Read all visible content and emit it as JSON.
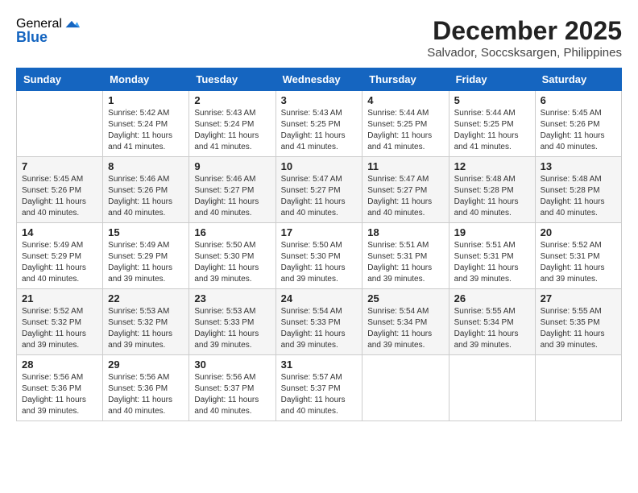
{
  "header": {
    "logo_general": "General",
    "logo_blue": "Blue",
    "month_title": "December 2025",
    "location": "Salvador, Soccsksargen, Philippines"
  },
  "days_of_week": [
    "Sunday",
    "Monday",
    "Tuesday",
    "Wednesday",
    "Thursday",
    "Friday",
    "Saturday"
  ],
  "weeks": [
    [
      {
        "day": "",
        "sunrise": "",
        "sunset": "",
        "daylight": ""
      },
      {
        "day": "1",
        "sunrise": "Sunrise: 5:42 AM",
        "sunset": "Sunset: 5:24 PM",
        "daylight": "Daylight: 11 hours and 41 minutes."
      },
      {
        "day": "2",
        "sunrise": "Sunrise: 5:43 AM",
        "sunset": "Sunset: 5:24 PM",
        "daylight": "Daylight: 11 hours and 41 minutes."
      },
      {
        "day": "3",
        "sunrise": "Sunrise: 5:43 AM",
        "sunset": "Sunset: 5:25 PM",
        "daylight": "Daylight: 11 hours and 41 minutes."
      },
      {
        "day": "4",
        "sunrise": "Sunrise: 5:44 AM",
        "sunset": "Sunset: 5:25 PM",
        "daylight": "Daylight: 11 hours and 41 minutes."
      },
      {
        "day": "5",
        "sunrise": "Sunrise: 5:44 AM",
        "sunset": "Sunset: 5:25 PM",
        "daylight": "Daylight: 11 hours and 41 minutes."
      },
      {
        "day": "6",
        "sunrise": "Sunrise: 5:45 AM",
        "sunset": "Sunset: 5:26 PM",
        "daylight": "Daylight: 11 hours and 40 minutes."
      }
    ],
    [
      {
        "day": "7",
        "sunrise": "Sunrise: 5:45 AM",
        "sunset": "Sunset: 5:26 PM",
        "daylight": "Daylight: 11 hours and 40 minutes."
      },
      {
        "day": "8",
        "sunrise": "Sunrise: 5:46 AM",
        "sunset": "Sunset: 5:26 PM",
        "daylight": "Daylight: 11 hours and 40 minutes."
      },
      {
        "day": "9",
        "sunrise": "Sunrise: 5:46 AM",
        "sunset": "Sunset: 5:27 PM",
        "daylight": "Daylight: 11 hours and 40 minutes."
      },
      {
        "day": "10",
        "sunrise": "Sunrise: 5:47 AM",
        "sunset": "Sunset: 5:27 PM",
        "daylight": "Daylight: 11 hours and 40 minutes."
      },
      {
        "day": "11",
        "sunrise": "Sunrise: 5:47 AM",
        "sunset": "Sunset: 5:27 PM",
        "daylight": "Daylight: 11 hours and 40 minutes."
      },
      {
        "day": "12",
        "sunrise": "Sunrise: 5:48 AM",
        "sunset": "Sunset: 5:28 PM",
        "daylight": "Daylight: 11 hours and 40 minutes."
      },
      {
        "day": "13",
        "sunrise": "Sunrise: 5:48 AM",
        "sunset": "Sunset: 5:28 PM",
        "daylight": "Daylight: 11 hours and 40 minutes."
      }
    ],
    [
      {
        "day": "14",
        "sunrise": "Sunrise: 5:49 AM",
        "sunset": "Sunset: 5:29 PM",
        "daylight": "Daylight: 11 hours and 40 minutes."
      },
      {
        "day": "15",
        "sunrise": "Sunrise: 5:49 AM",
        "sunset": "Sunset: 5:29 PM",
        "daylight": "Daylight: 11 hours and 39 minutes."
      },
      {
        "day": "16",
        "sunrise": "Sunrise: 5:50 AM",
        "sunset": "Sunset: 5:30 PM",
        "daylight": "Daylight: 11 hours and 39 minutes."
      },
      {
        "day": "17",
        "sunrise": "Sunrise: 5:50 AM",
        "sunset": "Sunset: 5:30 PM",
        "daylight": "Daylight: 11 hours and 39 minutes."
      },
      {
        "day": "18",
        "sunrise": "Sunrise: 5:51 AM",
        "sunset": "Sunset: 5:31 PM",
        "daylight": "Daylight: 11 hours and 39 minutes."
      },
      {
        "day": "19",
        "sunrise": "Sunrise: 5:51 AM",
        "sunset": "Sunset: 5:31 PM",
        "daylight": "Daylight: 11 hours and 39 minutes."
      },
      {
        "day": "20",
        "sunrise": "Sunrise: 5:52 AM",
        "sunset": "Sunset: 5:31 PM",
        "daylight": "Daylight: 11 hours and 39 minutes."
      }
    ],
    [
      {
        "day": "21",
        "sunrise": "Sunrise: 5:52 AM",
        "sunset": "Sunset: 5:32 PM",
        "daylight": "Daylight: 11 hours and 39 minutes."
      },
      {
        "day": "22",
        "sunrise": "Sunrise: 5:53 AM",
        "sunset": "Sunset: 5:32 PM",
        "daylight": "Daylight: 11 hours and 39 minutes."
      },
      {
        "day": "23",
        "sunrise": "Sunrise: 5:53 AM",
        "sunset": "Sunset: 5:33 PM",
        "daylight": "Daylight: 11 hours and 39 minutes."
      },
      {
        "day": "24",
        "sunrise": "Sunrise: 5:54 AM",
        "sunset": "Sunset: 5:33 PM",
        "daylight": "Daylight: 11 hours and 39 minutes."
      },
      {
        "day": "25",
        "sunrise": "Sunrise: 5:54 AM",
        "sunset": "Sunset: 5:34 PM",
        "daylight": "Daylight: 11 hours and 39 minutes."
      },
      {
        "day": "26",
        "sunrise": "Sunrise: 5:55 AM",
        "sunset": "Sunset: 5:34 PM",
        "daylight": "Daylight: 11 hours and 39 minutes."
      },
      {
        "day": "27",
        "sunrise": "Sunrise: 5:55 AM",
        "sunset": "Sunset: 5:35 PM",
        "daylight": "Daylight: 11 hours and 39 minutes."
      }
    ],
    [
      {
        "day": "28",
        "sunrise": "Sunrise: 5:56 AM",
        "sunset": "Sunset: 5:36 PM",
        "daylight": "Daylight: 11 hours and 39 minutes."
      },
      {
        "day": "29",
        "sunrise": "Sunrise: 5:56 AM",
        "sunset": "Sunset: 5:36 PM",
        "daylight": "Daylight: 11 hours and 40 minutes."
      },
      {
        "day": "30",
        "sunrise": "Sunrise: 5:56 AM",
        "sunset": "Sunset: 5:37 PM",
        "daylight": "Daylight: 11 hours and 40 minutes."
      },
      {
        "day": "31",
        "sunrise": "Sunrise: 5:57 AM",
        "sunset": "Sunset: 5:37 PM",
        "daylight": "Daylight: 11 hours and 40 minutes."
      },
      {
        "day": "",
        "sunrise": "",
        "sunset": "",
        "daylight": ""
      },
      {
        "day": "",
        "sunrise": "",
        "sunset": "",
        "daylight": ""
      },
      {
        "day": "",
        "sunrise": "",
        "sunset": "",
        "daylight": ""
      }
    ]
  ]
}
